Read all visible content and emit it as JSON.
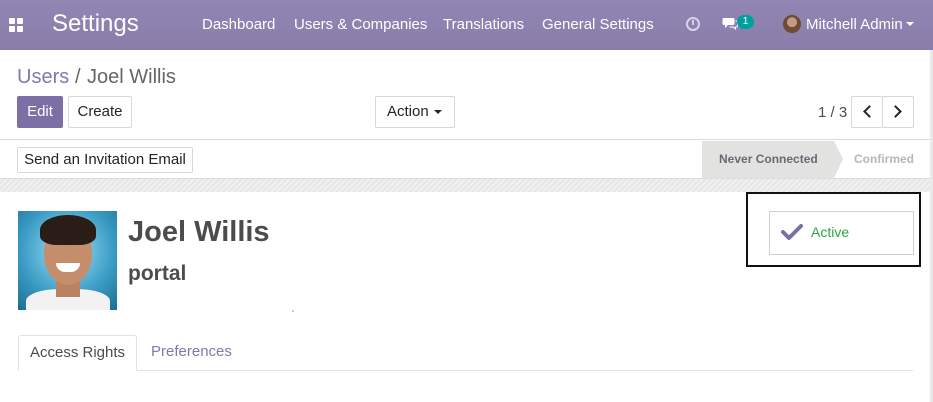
{
  "navbar": {
    "app_title": "Settings",
    "menu": [
      "Dashboard",
      "Users & Companies",
      "Translations",
      "General Settings"
    ],
    "chat_count": "1",
    "user_name": "Mitchell Admin",
    "bg_color": "#8f83b0"
  },
  "breadcrumb": {
    "parent": "Users",
    "separator": "/",
    "current": "Joel Willis"
  },
  "buttons": {
    "edit": "Edit",
    "create": "Create",
    "action": "Action",
    "invite": "Send an Invitation Email"
  },
  "pager": {
    "value": "1 / 3"
  },
  "statusbar": {
    "steps": [
      "Never Connected",
      "Confirmed"
    ],
    "current": "Never Connected"
  },
  "record": {
    "name": "Joel Willis",
    "subtitle": "portal",
    "active_label": "Active"
  },
  "tabs": [
    "Access Rights",
    "Preferences"
  ],
  "colors": {
    "primary": "#7c6fa6",
    "link": "#7c7bad",
    "active_green": "#28a745",
    "badge": "#00a09d"
  },
  "icons": [
    "apps-icon",
    "clock-icon",
    "chat-icon",
    "chevron-left-icon",
    "chevron-right-icon",
    "check-icon"
  ]
}
